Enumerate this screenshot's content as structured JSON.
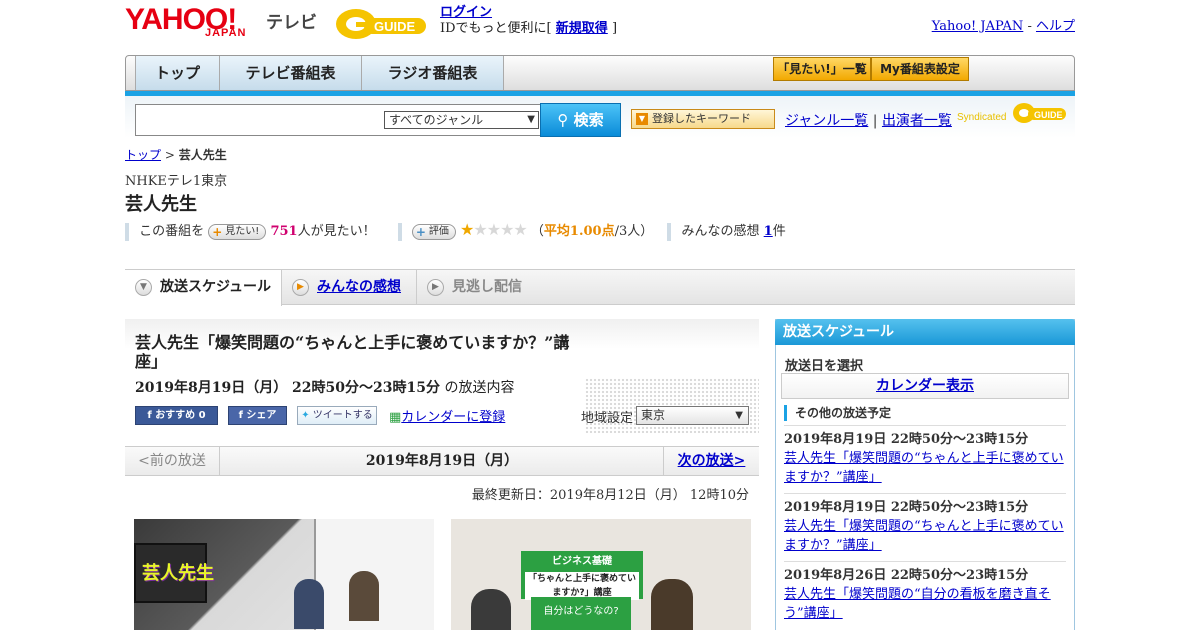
{
  "header": {
    "logo_main": "YAHOO!",
    "logo_sub": "JAPAN",
    "logo_tv": "テレビ",
    "login_label": "ログイン",
    "login_note_prefix": "IDでもっと便利に[",
    "signup_label": "新規取得",
    "login_note_suffix": "]",
    "yahoo_link": "Yahoo! JAPAN",
    "sep": " - ",
    "help_link": "ヘルプ"
  },
  "nav": {
    "tabs": [
      "トップ",
      "テレビ番組表",
      "ラジオ番組表"
    ],
    "want_list": "「見たい!」一覧",
    "my_settings": "My番組表設定"
  },
  "search": {
    "genre_selected": "すべてのジャンル",
    "button": "検索",
    "keyword_button": "登録したキーワード",
    "genre_list": "ジャンル一覧",
    "divider": "|",
    "cast_list": "出演者一覧",
    "syndicated": "Syndicated"
  },
  "breadcrumb": {
    "home": "トップ",
    "sep": ">",
    "current": "芸人先生"
  },
  "program": {
    "channel": "NHKEテレ1東京",
    "title": "芸人先生",
    "want_prefix": "この番組を",
    "want_pill": "見たい!",
    "want_count": "751",
    "want_suffix": "人が見たい！",
    "rate_pill": "評価",
    "rating": 1,
    "rating_max": 5,
    "avg_prefix": "（",
    "avg_label": "平均1.00点",
    "avg_suffix": "/3人）",
    "impressions_label": "みんなの感想",
    "impressions_count": "1",
    "impressions_suffix": "件"
  },
  "tabs": [
    {
      "label": "放送スケジュール"
    },
    {
      "label": "みんなの感想"
    },
    {
      "label": "見逃し配信"
    }
  ],
  "episode": {
    "title": "芸人先生「爆笑問題の“ちゃんと上手に褒めていますか？”講座」",
    "date_time": "2019年8月19日（月）  22時50分～23時15分",
    "time_suffix": "の放送内容",
    "fb_recommend": "おすすめ 0",
    "fb_share": "シェア",
    "tweet": "ツイートする",
    "calendar": "カレンダーに登録",
    "region_label": "地域設定",
    "region_selected": "東京"
  },
  "pager": {
    "prev": "<前の放送",
    "date": "2019年8月19日（月）",
    "next": "次の放送>"
  },
  "updated": "最終更新日：2019年8月12日（月） 12時10分",
  "photos": {
    "logo_text": "芸人先生",
    "sign_line1": "ビジネス基礎",
    "sign_line2": "「ちゃんと上手に褒めていますか?」講座",
    "sign_line3": "自分はどうなの?"
  },
  "sidebar": {
    "title": "放送スケジュール",
    "select_date": "放送日を選択",
    "calendar_button": "カレンダー表示",
    "other_heading": "その他の放送予定",
    "items": [
      {
        "date": "2019年8月19日  22時50分～23時15分",
        "title": "芸人先生「爆笑問題の“ちゃんと上手に褒めていますか？”講座」"
      },
      {
        "date": "2019年8月19日  22時50分～23時15分",
        "title": "芸人先生「爆笑問題の“ちゃんと上手に褒めていますか？”講座」"
      },
      {
        "date": "2019年8月26日  22時50分～23時15分",
        "title": "芸人先生「爆笑問題の“自分の看板を磨き直そう”講座」"
      }
    ]
  },
  "colors": {
    "accent_blue": "#1ba2e4",
    "yahoo_red": "#e60012",
    "gold": "#f2a800",
    "link": "#0000cc",
    "star": "#f0a800"
  }
}
